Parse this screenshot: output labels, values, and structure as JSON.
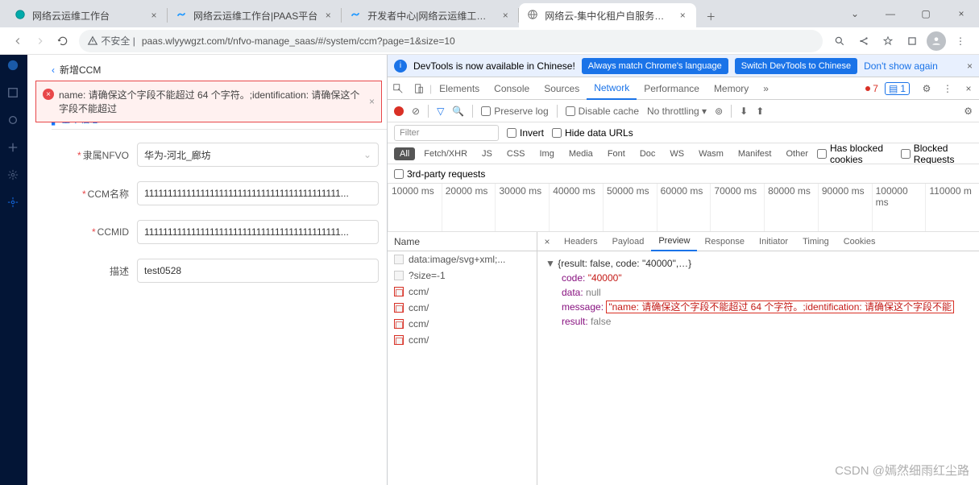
{
  "tabs": [
    {
      "title": "网络云运维工作台",
      "fav": "teal"
    },
    {
      "title": "网络云运维工作台|PAAS平台",
      "fav": "cloud"
    },
    {
      "title": "开发者中心|网络云运维工作台",
      "fav": "cloud"
    },
    {
      "title": "网络云-集中化租户自服务平台",
      "fav": "globe",
      "active": true
    }
  ],
  "addressbar": {
    "warn": "不安全",
    "url": "paas.wlyywgzt.com/t/nfvo-manage_saas/#/system/ccm?page=1&size=10"
  },
  "page": {
    "crumb_icon": "‹",
    "crumb": "新增CCM",
    "error": "name: 请确保这个字段不能超过 64 个字符。;identification: 请确保这个字段不能超过",
    "section": "基本信息",
    "form": {
      "nfvo_label": "隶属NFVO",
      "nfvo_value": "华为-河北_廊坊",
      "name_label": "CCM名称",
      "name_value": "111111111111111111111111111111111111111111...",
      "id_label": "CCMID",
      "id_value": "111111111111111111111111111111111111111111...",
      "desc_label": "描述",
      "desc_value": "test0528"
    }
  },
  "devtools": {
    "infobar": {
      "text": "DevTools is now available in Chinese!",
      "btn1": "Always match Chrome's language",
      "btn2": "Switch DevTools to Chinese",
      "link": "Don't show again"
    },
    "tabs": [
      "Elements",
      "Console",
      "Sources",
      "Network",
      "Performance",
      "Memory"
    ],
    "active_tab": "Network",
    "err_count": "7",
    "msg_count": "1",
    "toolbar": {
      "preserve": "Preserve log",
      "disable": "Disable cache",
      "throttle": "No throttling"
    },
    "filter": {
      "placeholder": "Filter",
      "invert": "Invert",
      "hide": "Hide data URLs"
    },
    "types": [
      "All",
      "Fetch/XHR",
      "JS",
      "CSS",
      "Img",
      "Media",
      "Font",
      "Doc",
      "WS",
      "Wasm",
      "Manifest",
      "Other"
    ],
    "type_checks": {
      "blocked": "Has blocked cookies",
      "blockedreq": "Blocked Requests"
    },
    "thirdp": "3rd-party requests",
    "timeline": [
      "10000 ms",
      "20000 ms",
      "30000 ms",
      "40000 ms",
      "50000 ms",
      "60000 ms",
      "70000 ms",
      "80000 ms",
      "90000 ms",
      "100000 ms",
      "110000 m"
    ],
    "reqheader": "Name",
    "requests": [
      {
        "name": "data:image/svg+xml;...",
        "icon": "img"
      },
      {
        "name": "?size=-1",
        "icon": "doc"
      },
      {
        "name": "ccm/",
        "icon": "red"
      },
      {
        "name": "ccm/",
        "icon": "red"
      },
      {
        "name": "ccm/",
        "icon": "red"
      },
      {
        "name": "ccm/",
        "icon": "red"
      }
    ],
    "detail_tabs": [
      "Headers",
      "Payload",
      "Preview",
      "Response",
      "Initiator",
      "Timing",
      "Cookies"
    ],
    "detail_active": "Preview",
    "preview": {
      "top": "{result: false, code: \"40000\",…}",
      "code_k": "code:",
      "code_v": "\"40000\"",
      "data_k": "data:",
      "data_v": "null",
      "msg_k": "message:",
      "msg_v": "\"name: 请确保这个字段不能超过 64 个字符。;identification: 请确保这个字段不能",
      "res_k": "result:",
      "res_v": "false"
    }
  },
  "watermark": "CSDN @嫣然细雨红尘路"
}
